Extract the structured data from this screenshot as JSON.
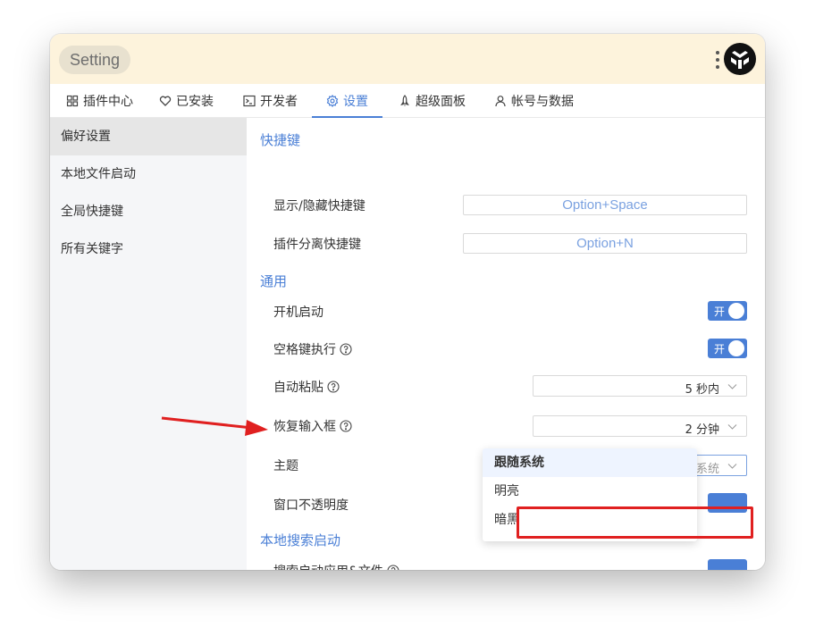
{
  "window": {
    "title": "Setting"
  },
  "colors": {
    "accent": "#4a7fd6",
    "annotation": "#e02020",
    "titlebar_bg": "#fdf3dc"
  },
  "tabs": [
    {
      "label": "插件中心",
      "icon": "grid-icon"
    },
    {
      "label": "已安装",
      "icon": "heart-icon"
    },
    {
      "label": "开发者",
      "icon": "terminal-icon"
    },
    {
      "label": "设置",
      "icon": "gear-icon",
      "active": true
    },
    {
      "label": "超级面板",
      "icon": "rocket-icon"
    },
    {
      "label": "帐号与数据",
      "icon": "user-icon"
    }
  ],
  "sidebar": {
    "items": [
      {
        "label": "偏好设置",
        "active": true
      },
      {
        "label": "本地文件启动"
      },
      {
        "label": "全局快捷键"
      },
      {
        "label": "所有关键字"
      }
    ]
  },
  "content": {
    "shortcuts": {
      "title": "快捷键",
      "rows": [
        {
          "label": "显示/隐藏快捷键",
          "value": "Option+Space"
        },
        {
          "label": "插件分离快捷键",
          "value": "Option+N"
        }
      ]
    },
    "general": {
      "title": "通用",
      "launch_at_login": {
        "label": "开机启动",
        "switch": "开"
      },
      "space_exec": {
        "label": "空格键执行",
        "switch": "开"
      },
      "auto_paste": {
        "label": "自动粘贴",
        "value": "5 秒内"
      },
      "restore_input": {
        "label": "恢复输入框",
        "value": "2 分钟"
      },
      "theme": {
        "label": "主题",
        "value": "跟随系统"
      },
      "opacity": {
        "label": "窗口不透明度"
      }
    },
    "local_search": {
      "title": "本地搜索启动",
      "search_apps": {
        "label": "搜索启动应用&文件"
      }
    }
  },
  "theme_dropdown": {
    "options": [
      {
        "label": "跟随系统",
        "selected": true
      },
      {
        "label": "明亮"
      },
      {
        "label": "暗黑"
      }
    ]
  }
}
